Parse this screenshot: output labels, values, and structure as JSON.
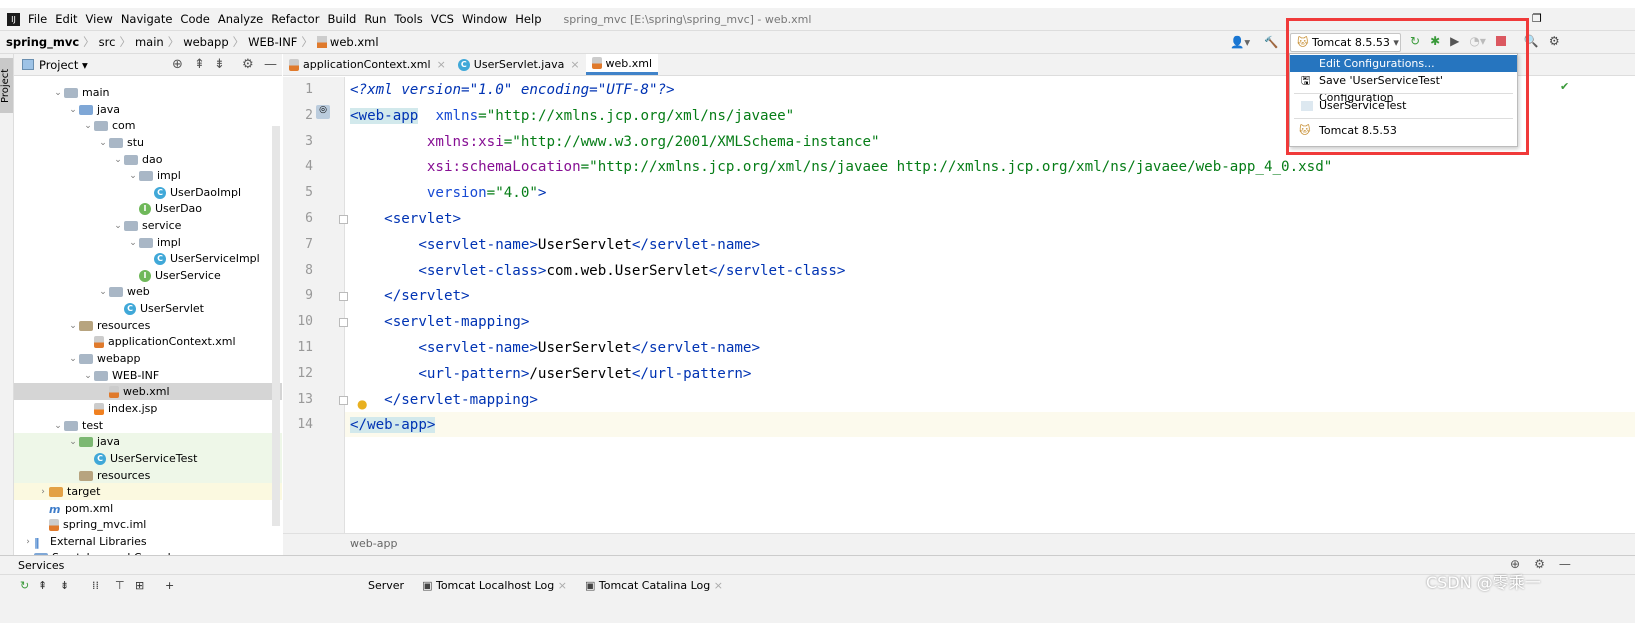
{
  "menubar": {
    "items": [
      "File",
      "Edit",
      "View",
      "Navigate",
      "Code",
      "Analyze",
      "Refactor",
      "Build",
      "Run",
      "Tools",
      "VCS",
      "Window",
      "Help"
    ],
    "title": "spring_mvc [E:\\spring\\spring_mvc] - web.xml"
  },
  "navbar": {
    "crumbs": [
      "spring_mvc",
      "src",
      "main",
      "webapp",
      "WEB-INF",
      "web.xml"
    ]
  },
  "stripe": {
    "label": "Project"
  },
  "project": {
    "title": "Project ▾",
    "tree": [
      {
        "label": "main",
        "depth": 2,
        "icon": "folder",
        "open": true
      },
      {
        "label": "java",
        "depth": 3,
        "icon": "folder-blue",
        "open": true
      },
      {
        "label": "com",
        "depth": 4,
        "icon": "folder",
        "open": true
      },
      {
        "label": "stu",
        "depth": 5,
        "icon": "folder",
        "open": true
      },
      {
        "label": "dao",
        "depth": 6,
        "icon": "folder",
        "open": true
      },
      {
        "label": "impl",
        "depth": 7,
        "icon": "folder",
        "open": true
      },
      {
        "label": "UserDaoImpl",
        "depth": 8,
        "icon": "class"
      },
      {
        "label": "UserDao",
        "depth": 7,
        "icon": "interface"
      },
      {
        "label": "service",
        "depth": 6,
        "icon": "folder",
        "open": true
      },
      {
        "label": "impl",
        "depth": 7,
        "icon": "folder",
        "open": true
      },
      {
        "label": "UserServiceImpl",
        "depth": 8,
        "icon": "class"
      },
      {
        "label": "UserService",
        "depth": 7,
        "icon": "interface"
      },
      {
        "label": "web",
        "depth": 5,
        "icon": "folder",
        "open": true
      },
      {
        "label": "UserServlet",
        "depth": 6,
        "icon": "class"
      },
      {
        "label": "resources",
        "depth": 3,
        "icon": "folder-res",
        "open": true
      },
      {
        "label": "applicationContext.xml",
        "depth": 4,
        "icon": "xml"
      },
      {
        "label": "webapp",
        "depth": 3,
        "icon": "folder",
        "open": true
      },
      {
        "label": "WEB-INF",
        "depth": 4,
        "icon": "folder",
        "open": true
      },
      {
        "label": "web.xml",
        "depth": 5,
        "icon": "xml",
        "selected": true
      },
      {
        "label": "index.jsp",
        "depth": 4,
        "icon": "jsp"
      },
      {
        "label": "test",
        "depth": 2,
        "icon": "folder",
        "open": true
      },
      {
        "label": "java",
        "depth": 3,
        "icon": "folder-green",
        "open": true,
        "test": true
      },
      {
        "label": "UserServiceTest",
        "depth": 4,
        "icon": "class",
        "test": true
      },
      {
        "label": "resources",
        "depth": 3,
        "icon": "folder-res",
        "test": true
      },
      {
        "label": "target",
        "depth": 1,
        "icon": "folder-orange",
        "closed": true,
        "target": true
      },
      {
        "label": "pom.xml",
        "depth": 1,
        "icon": "maven"
      },
      {
        "label": "spring_mvc.iml",
        "depth": 1,
        "icon": "xml"
      },
      {
        "label": "External Libraries",
        "depth": 0,
        "icon": "libraries",
        "closed": true
      },
      {
        "label": "Scratches and Consoles",
        "depth": 0,
        "icon": "scratches",
        "closed": true
      }
    ]
  },
  "tabs": [
    {
      "label": "applicationContext.xml",
      "icon": "xml",
      "active": false
    },
    {
      "label": "UserServlet.java",
      "icon": "class",
      "active": false
    },
    {
      "label": "web.xml",
      "icon": "xml",
      "active": true
    }
  ],
  "editor": {
    "lines": [
      [
        [
          "pi",
          "<?xml version=\"1.0\" encoding=\"UTF-8\"?>"
        ]
      ],
      [
        [
          "t hl",
          "<web-app"
        ],
        [
          "",
          "  "
        ],
        [
          "a",
          "xmlns"
        ],
        [
          "s",
          "=\"http://xmlns.jcp.org/xml/ns/javaee\""
        ]
      ],
      [
        [
          "",
          "         "
        ],
        [
          "ns",
          "xmlns:xsi"
        ],
        [
          "s",
          "=\"http://www.w3.org/2001/XMLSchema-instance\""
        ]
      ],
      [
        [
          "",
          "         "
        ],
        [
          "ns",
          "xsi:schemaLocation"
        ],
        [
          "s",
          "=\"http://xmlns.jcp.org/xml/ns/javaee http://xmlns.jcp.org/xml/ns/javaee/web-app_4_0.xsd\""
        ]
      ],
      [
        [
          "",
          "         "
        ],
        [
          "a",
          "version"
        ],
        [
          "s",
          "=\"4.0\""
        ],
        [
          "t",
          ">"
        ]
      ],
      [
        [
          "t",
          "    <servlet>"
        ]
      ],
      [
        [
          "t",
          "        <servlet-name>"
        ],
        [
          "",
          "UserServlet"
        ],
        [
          "t",
          "</servlet-name>"
        ]
      ],
      [
        [
          "t",
          "        <servlet-class>"
        ],
        [
          "",
          "com.web.UserServlet"
        ],
        [
          "t",
          "</servlet-class>"
        ]
      ],
      [
        [
          "t",
          "    </servlet>"
        ]
      ],
      [
        [
          "t",
          "    <servlet-mapping>"
        ]
      ],
      [
        [
          "t",
          "        <servlet-name>"
        ],
        [
          "",
          "UserServlet"
        ],
        [
          "t",
          "</servlet-name>"
        ]
      ],
      [
        [
          "t",
          "        <url-pattern>"
        ],
        [
          "",
          "/userServlet"
        ],
        [
          "t",
          "</url-pattern>"
        ]
      ],
      [
        [
          "t",
          "    </servlet-mapping>"
        ]
      ],
      [
        [
          "t hl",
          "</web-app>"
        ]
      ]
    ],
    "breadcrumb": "web-app"
  },
  "run": {
    "config": "Tomcat 8.5.53",
    "popup": [
      "Edit Configurations...",
      "Save 'UserServiceTest' Configuration",
      "UserServiceTest",
      "Tomcat 8.5.53"
    ]
  },
  "services": {
    "title": "Services",
    "tabs": [
      "Server",
      "Tomcat Localhost Log",
      "Tomcat Catalina Log"
    ]
  },
  "watermark": "CSDN @零乘一",
  "colors": {
    "accent": "#2675bf",
    "highlight_box": "#f03a3a"
  }
}
